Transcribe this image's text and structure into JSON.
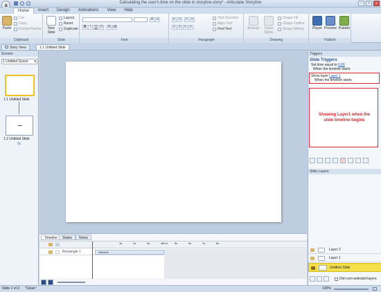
{
  "window": {
    "title": "Calculating the user's time on the slide in storyline.story* - Articulate Storyline",
    "app_button": "a"
  },
  "ribbon_tabs": [
    "Home",
    "Insert",
    "Design",
    "Animations",
    "View",
    "Help"
  ],
  "ribbon": {
    "clipboard": {
      "label": "Clipboard",
      "paste": "Paste",
      "cut": "Cut",
      "copy": "Copy",
      "format_painter": "Format Painter"
    },
    "slide": {
      "label": "Slide",
      "new_slide": "New Slide",
      "layout": "Layout",
      "reset": "Reset",
      "duplicate": "Duplicate"
    },
    "font": {
      "label": "Font"
    },
    "paragraph": {
      "label": "Paragraph",
      "text_direction": "Text Direction",
      "align_text": "Align Text",
      "find_text": "Find Text"
    },
    "drawing": {
      "label": "Drawing",
      "arrange": "Arrange",
      "quick_styles": "Quick Styles",
      "shape_fill": "Shape Fill",
      "shape_outline": "Shape Outline",
      "shape_effects": "Shape Effects"
    },
    "publish": {
      "label": "Publish",
      "player": "Player",
      "preview": "Preview",
      "publish": "Publish"
    }
  },
  "doc_tabs": {
    "story_view": "Story View",
    "slide_tab": "1.1 Untitled Slide"
  },
  "scenes": {
    "header": "Scenes",
    "selected_scene": "1 Untitled Scene",
    "slides": [
      "1.1 Untitled Slide",
      "1.2 Untitled Slide"
    ]
  },
  "timeline": {
    "tabs": [
      "Timeline",
      "States",
      "Notes"
    ],
    "object_name": "Rectangle 1",
    "object_text": "%time%",
    "ticks": [
      "1s",
      "2s",
      "3s",
      "4s",
      "5s",
      "6s",
      "7s",
      "8s"
    ],
    "end_marker": "End"
  },
  "triggers": {
    "header": "Triggers",
    "section": "Slide Triggers",
    "trigger1": {
      "prefix": "Set time equal to",
      "value": "0.00",
      "condition": "When the timeline starts"
    },
    "trigger2": {
      "prefix": "Show layer",
      "value": "Layer 1",
      "condition": "When the timeline starts"
    },
    "annotation": "Showing Layer1 when the slide timeline begins"
  },
  "slide_layers": {
    "header": "Slide Layers",
    "layers": [
      "Layer 2",
      "Layer 1"
    ],
    "base": "Untitled Slide",
    "dim_label": "Dim non-selected layers"
  },
  "status": {
    "slide": "Slide 1 of 2",
    "theme": "\"Clean\"",
    "zoom": "100%"
  },
  "colors": {
    "accent": "#2b5797",
    "annotation_red": "#d8262c",
    "layer_yellow": "#f6e04a"
  }
}
